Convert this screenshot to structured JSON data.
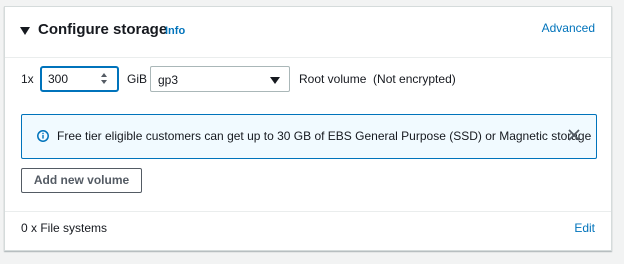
{
  "panel": {
    "title": "Configure storage",
    "info_link": "Info",
    "advanced_link": "Advanced"
  },
  "volume_row": {
    "multiplier": "1x",
    "size_value": "300",
    "size_unit": "GiB",
    "volume_type": "gp3",
    "description": "Root volume  (Not encrypted)"
  },
  "alert": {
    "message": "Free tier eligible customers can get up to 30 GB of EBS General Purpose (SSD) or Magnetic storage",
    "icon": "info-circle-icon",
    "close_icon": "close-icon"
  },
  "actions": {
    "add_volume_label": "Add new volume"
  },
  "file_systems": {
    "label": "0 x File systems",
    "edit_link": "Edit"
  },
  "colors": {
    "link": "#0073bb",
    "alert_bg": "#f1faff",
    "alert_border": "#0073bb",
    "text": "#16191f"
  }
}
